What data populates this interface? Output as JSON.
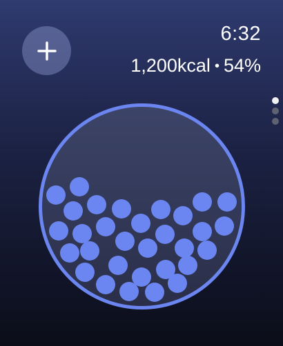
{
  "header": {
    "time": "6:32",
    "calories": "1,200kcal",
    "separator": "•",
    "percent": "54%"
  },
  "add_button": {
    "icon": "plus-icon"
  },
  "page_indicator": {
    "count": 3,
    "active_index": 0
  },
  "progress_bowl": {
    "fill_percent": 54,
    "accent_color": "#6b86f0",
    "ring_color": "#6b86f0",
    "bowl_color": "#3a4266"
  },
  "colors": {
    "background_top": "#2f3a6f",
    "background_bottom": "#0b0d18",
    "button_bg": "#7b83b8"
  }
}
